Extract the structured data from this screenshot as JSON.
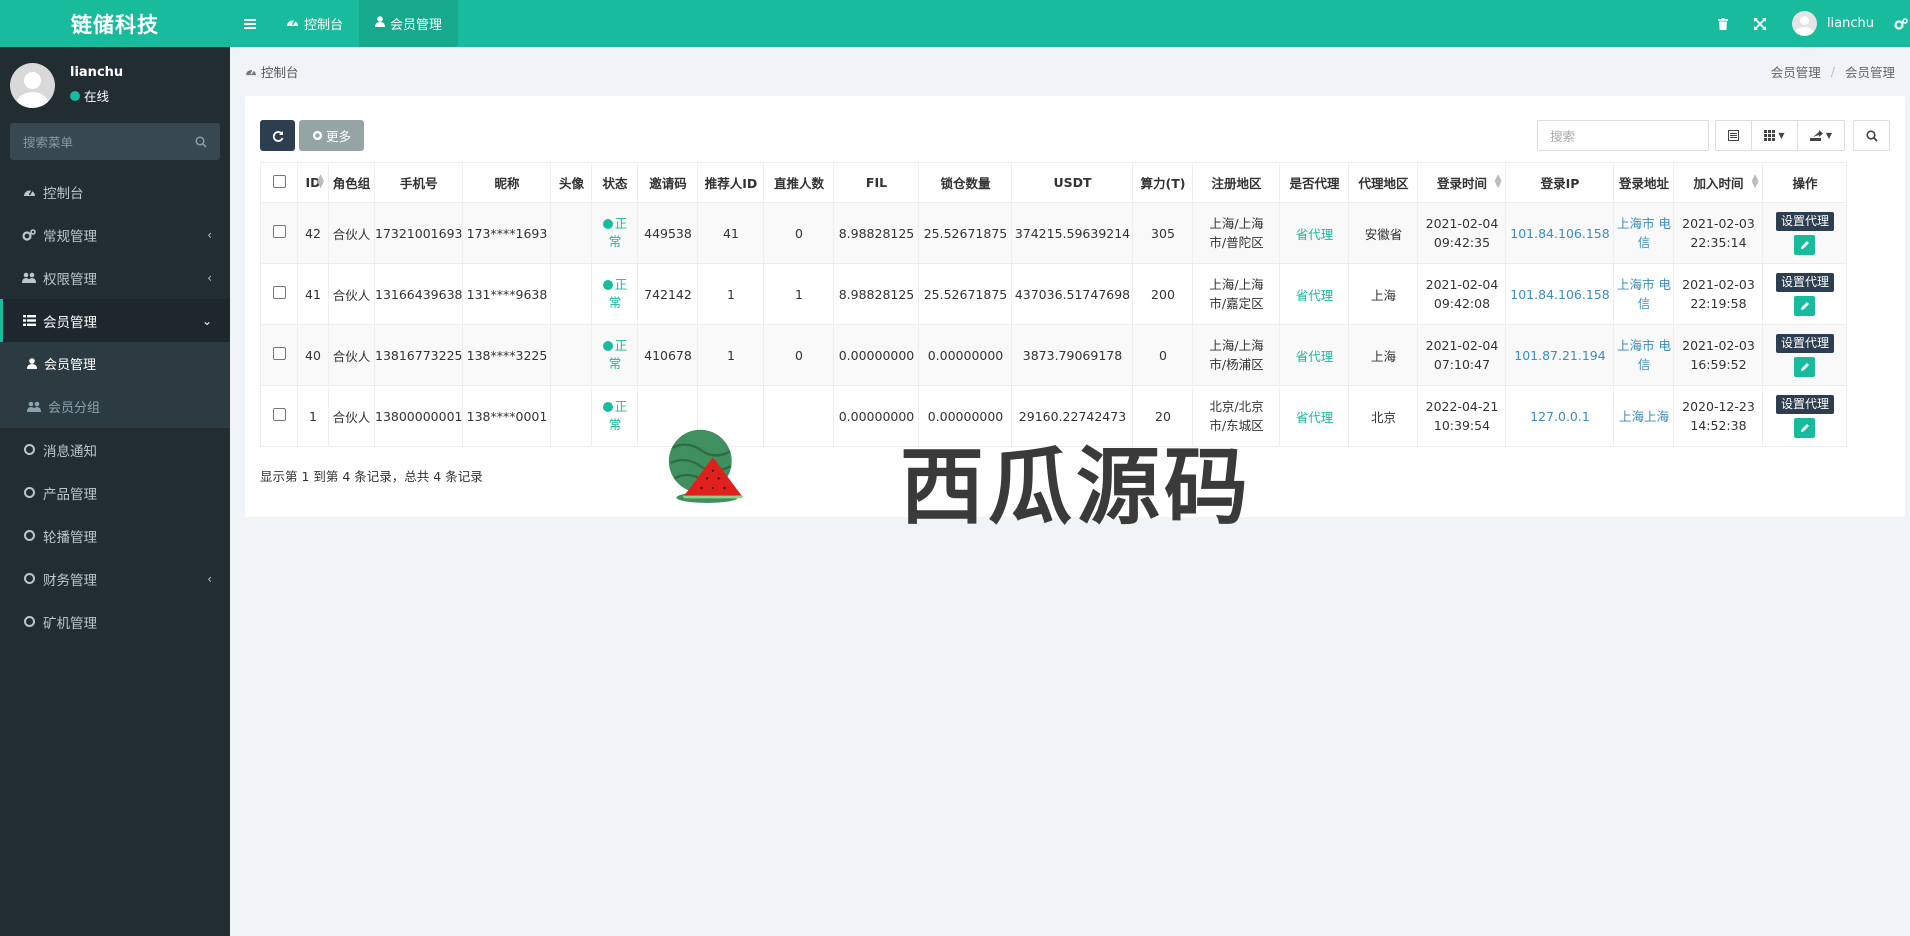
{
  "app": {
    "logo": "链储科技"
  },
  "user": {
    "name": "lianchu",
    "status": "在线"
  },
  "sidebar": {
    "search_placeholder": "搜索菜单",
    "items": [
      {
        "label": "控制台",
        "icon": "dashboard-icon"
      },
      {
        "label": "常规管理",
        "icon": "cogs-icon",
        "arrow": "‹"
      },
      {
        "label": "权限管理",
        "icon": "users-icon",
        "arrow": "‹"
      },
      {
        "label": "会员管理",
        "icon": "list-icon",
        "arrow": "⌄"
      },
      {
        "label": "消息通知",
        "icon": "circle-icon"
      },
      {
        "label": "产品管理",
        "icon": "circle-icon"
      },
      {
        "label": "轮播管理",
        "icon": "circle-icon"
      },
      {
        "label": "财务管理",
        "icon": "circle-icon",
        "arrow": "‹"
      },
      {
        "label": "矿机管理",
        "icon": "circle-icon"
      }
    ],
    "subitems": [
      {
        "label": "会员管理",
        "icon": "user-icon"
      },
      {
        "label": "会员分组",
        "icon": "users-icon"
      }
    ]
  },
  "topbar": {
    "tabs": [
      {
        "label": "控制台",
        "icon": "dashboard-icon"
      },
      {
        "label": "会员管理",
        "icon": "user-icon"
      }
    ],
    "username": "lianchu"
  },
  "header": {
    "title": "控制台",
    "breadcrumb": [
      "会员管理",
      "会员管理"
    ]
  },
  "toolbar": {
    "more_label": "更多",
    "search_placeholder": "搜索"
  },
  "table": {
    "columns": [
      "ID",
      "角色组",
      "手机号",
      "昵称",
      "头像",
      "状态",
      "邀请码",
      "推荐人ID",
      "直推人数",
      "FIL",
      "锁仓数量",
      "USDT",
      "算力(T)",
      "注册地区",
      "是否代理",
      "代理地区",
      "登录时间",
      "登录IP",
      "登录地址",
      "加入时间",
      "操作"
    ],
    "rows": [
      {
        "id": "42",
        "role": "合伙人",
        "phone": "17321001693",
        "nick": "173****1693",
        "status1": "正",
        "status2": "常",
        "invite": "449538",
        "ref": "41",
        "direct": "0",
        "fil": "8.98828125",
        "lock": "25.52671875",
        "usdt": "374215.59639214",
        "power": "305",
        "region1": "上海/上海",
        "region2": "市/普陀区",
        "agent": "省代理",
        "agent_region": "安徽省",
        "login_date": "2021-02-04",
        "login_time": "09:42:35",
        "ip": "101.84.106.158",
        "addr1": "上海市 电",
        "addr2": "信",
        "join_date": "2021-02-03",
        "join_time": "22:35:14"
      },
      {
        "id": "41",
        "role": "合伙人",
        "phone": "13166439638",
        "nick": "131****9638",
        "status1": "正",
        "status2": "常",
        "invite": "742142",
        "ref": "1",
        "direct": "1",
        "fil": "8.98828125",
        "lock": "25.52671875",
        "usdt": "437036.51747698",
        "power": "200",
        "region1": "上海/上海",
        "region2": "市/嘉定区",
        "agent": "省代理",
        "agent_region": "上海",
        "login_date": "2021-02-04",
        "login_time": "09:42:08",
        "ip": "101.84.106.158",
        "addr1": "上海市 电",
        "addr2": "信",
        "join_date": "2021-02-03",
        "join_time": "22:19:58"
      },
      {
        "id": "40",
        "role": "合伙人",
        "phone": "13816773225",
        "nick": "138****3225",
        "status1": "正",
        "status2": "常",
        "invite": "410678",
        "ref": "1",
        "direct": "0",
        "fil": "0.00000000",
        "lock": "0.00000000",
        "usdt": "3873.79069178",
        "power": "0",
        "region1": "上海/上海",
        "region2": "市/杨浦区",
        "agent": "省代理",
        "agent_region": "上海",
        "login_date": "2021-02-04",
        "login_time": "07:10:47",
        "ip": "101.87.21.194",
        "addr1": "上海市 电",
        "addr2": "信",
        "join_date": "2021-02-03",
        "join_time": "16:59:52"
      },
      {
        "id": "1",
        "role": "合伙人",
        "phone": "13800000001",
        "nick": "138****0001",
        "status1": "正",
        "status2": "常",
        "invite": "",
        "ref": "",
        "direct": "",
        "fil": "0.00000000",
        "lock": "0.00000000",
        "usdt": "29160.22742473",
        "power": "20",
        "region1": "北京/北京",
        "region2": "市/东城区",
        "agent": "省代理",
        "agent_region": "北京",
        "login_date": "2022-04-21",
        "login_time": "10:39:54",
        "ip": "127.0.0.1",
        "addr1": "上海上海",
        "addr2": "",
        "join_date": "2020-12-23",
        "join_time": "14:52:38"
      }
    ],
    "op_label": "设置代理",
    "footer": "显示第 1 到第 4 条记录，总共 4 条记录"
  },
  "watermark": {
    "text": "西瓜源码"
  },
  "colors": {
    "primary": "#18bc9c",
    "sidebar": "#222d32",
    "dark_button": "#2c3e50",
    "link": "#3c8dbc"
  }
}
